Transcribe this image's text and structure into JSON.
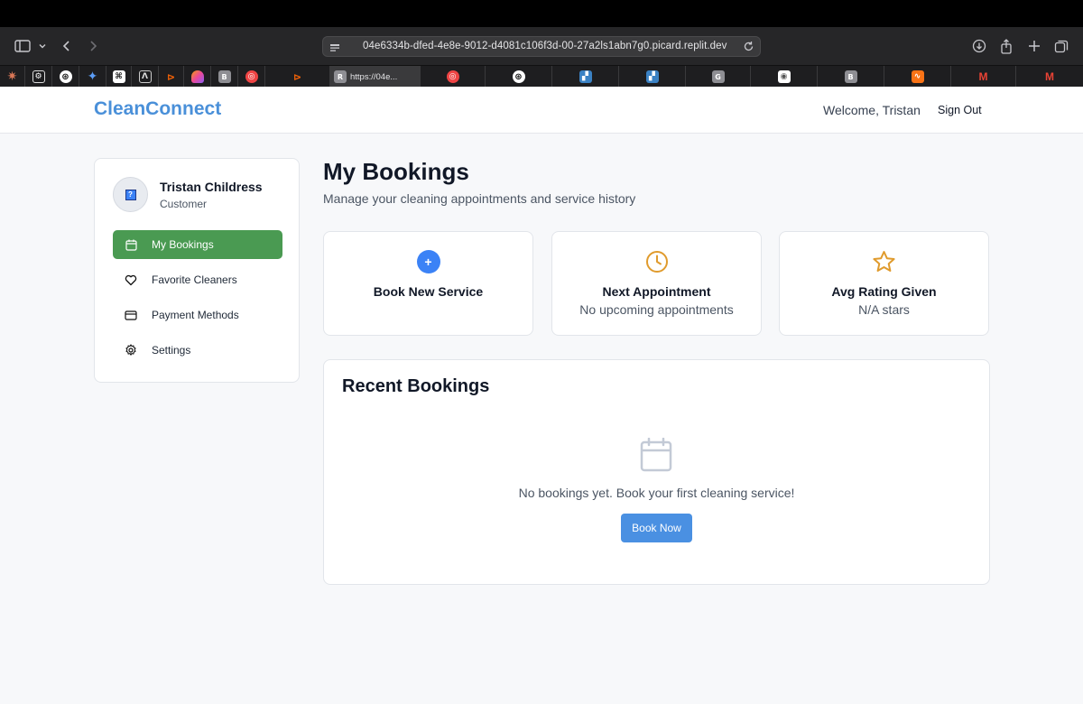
{
  "browser": {
    "url": "04e6334b-dfed-4e8e-9012-d4081c106f3d-00-27a2ls1abn7g0.picard.replit.dev",
    "active_tab_title": "https://04e...",
    "tab_favicon_letters": [
      "B",
      "R",
      "G",
      "B"
    ]
  },
  "header": {
    "logo": "CleanConnect",
    "welcome": "Welcome, Tristan",
    "sign_out": "Sign Out"
  },
  "sidebar": {
    "user_name": "Tristan Childress",
    "user_role": "Customer",
    "avatar_glyph": "?",
    "items": [
      {
        "label": "My Bookings",
        "icon": "calendar-icon",
        "active": true
      },
      {
        "label": "Favorite Cleaners",
        "icon": "heart-icon",
        "active": false
      },
      {
        "label": "Payment Methods",
        "icon": "credit-card-icon",
        "active": false
      },
      {
        "label": "Settings",
        "icon": "gear-icon",
        "active": false
      }
    ]
  },
  "main": {
    "title": "My Bookings",
    "subtitle": "Manage your cleaning appointments and service history",
    "cards": [
      {
        "icon": "plus-icon",
        "title": "Book New Service",
        "subtitle": ""
      },
      {
        "icon": "clock-icon",
        "title": "Next Appointment",
        "subtitle": "No upcoming appointments"
      },
      {
        "icon": "star-icon",
        "title": "Avg Rating Given",
        "subtitle": "N/A stars"
      }
    ],
    "plus_glyph": "+",
    "recent": {
      "title": "Recent Bookings",
      "empty_text": "No bookings yet. Book your first cleaning service!",
      "button": "Book Now"
    }
  },
  "colors": {
    "brand": "#4a90d9",
    "active_nav": "#4a9a52",
    "primary_button": "#4a90e2",
    "clock": "#e09b2d",
    "star": "#e09b2d"
  }
}
